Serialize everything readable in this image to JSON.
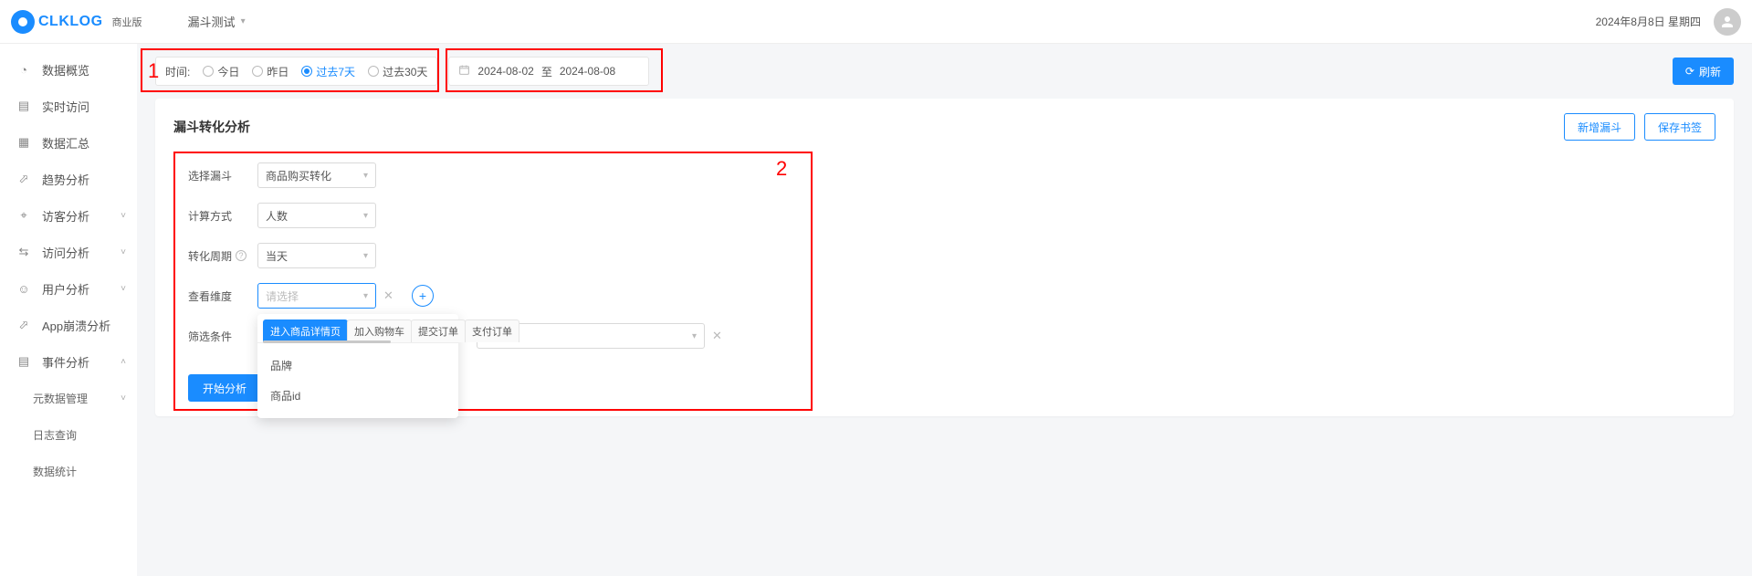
{
  "header": {
    "logo_text": "CLKLOG",
    "edition": "商业版",
    "project": "漏斗测试",
    "date": "2024年8月8日 星期四"
  },
  "sidebar": {
    "items": [
      {
        "label": "数据概览",
        "icon": "dashboard"
      },
      {
        "label": "实时访问",
        "icon": "realtime"
      },
      {
        "label": "数据汇总",
        "icon": "summary"
      },
      {
        "label": "趋势分析",
        "icon": "trend"
      },
      {
        "label": "访客分析",
        "icon": "visitor",
        "expandable": true
      },
      {
        "label": "访问分析",
        "icon": "visit",
        "expandable": true
      },
      {
        "label": "用户分析",
        "icon": "user",
        "expandable": true
      },
      {
        "label": "App崩溃分析",
        "icon": "crash"
      },
      {
        "label": "事件分析",
        "icon": "event",
        "expandable": true,
        "expanded": true
      },
      {
        "label": "元数据管理",
        "sub": true,
        "expandable": true
      },
      {
        "label": "日志查询",
        "sub": true
      },
      {
        "label": "数据统计",
        "sub": true
      }
    ]
  },
  "toolbar": {
    "time_label": "时间:",
    "options": [
      {
        "label": "今日",
        "on": false
      },
      {
        "label": "昨日",
        "on": false
      },
      {
        "label": "过去7天",
        "on": true
      },
      {
        "label": "过去30天",
        "on": false
      }
    ],
    "date_start": "2024-08-02",
    "date_sep": "至",
    "date_end": "2024-08-08",
    "refresh": "刷新"
  },
  "panel": {
    "title": "漏斗转化分析",
    "btn_new": "新增漏斗",
    "btn_save": "保存书签",
    "rows": {
      "funnel_label": "选择漏斗",
      "funnel_value": "商品购买转化",
      "calc_label": "计算方式",
      "calc_value": "人数",
      "period_label": "转化周期",
      "period_value": "当天",
      "dim_label": "查看维度",
      "dim_placeholder": "请选择",
      "filter_label": "筛选条件"
    },
    "analyze_btn": "开始分析"
  },
  "dropdown": {
    "tabs": [
      {
        "label": "进入商品详情页",
        "on": true
      },
      {
        "label": "加入购物车",
        "on": false
      },
      {
        "label": "提交订单",
        "on": false
      },
      {
        "label": "支付订单",
        "on": false
      }
    ],
    "items": [
      "品牌",
      "商品id"
    ]
  },
  "annotations": {
    "label1": "1",
    "label2": "2"
  }
}
